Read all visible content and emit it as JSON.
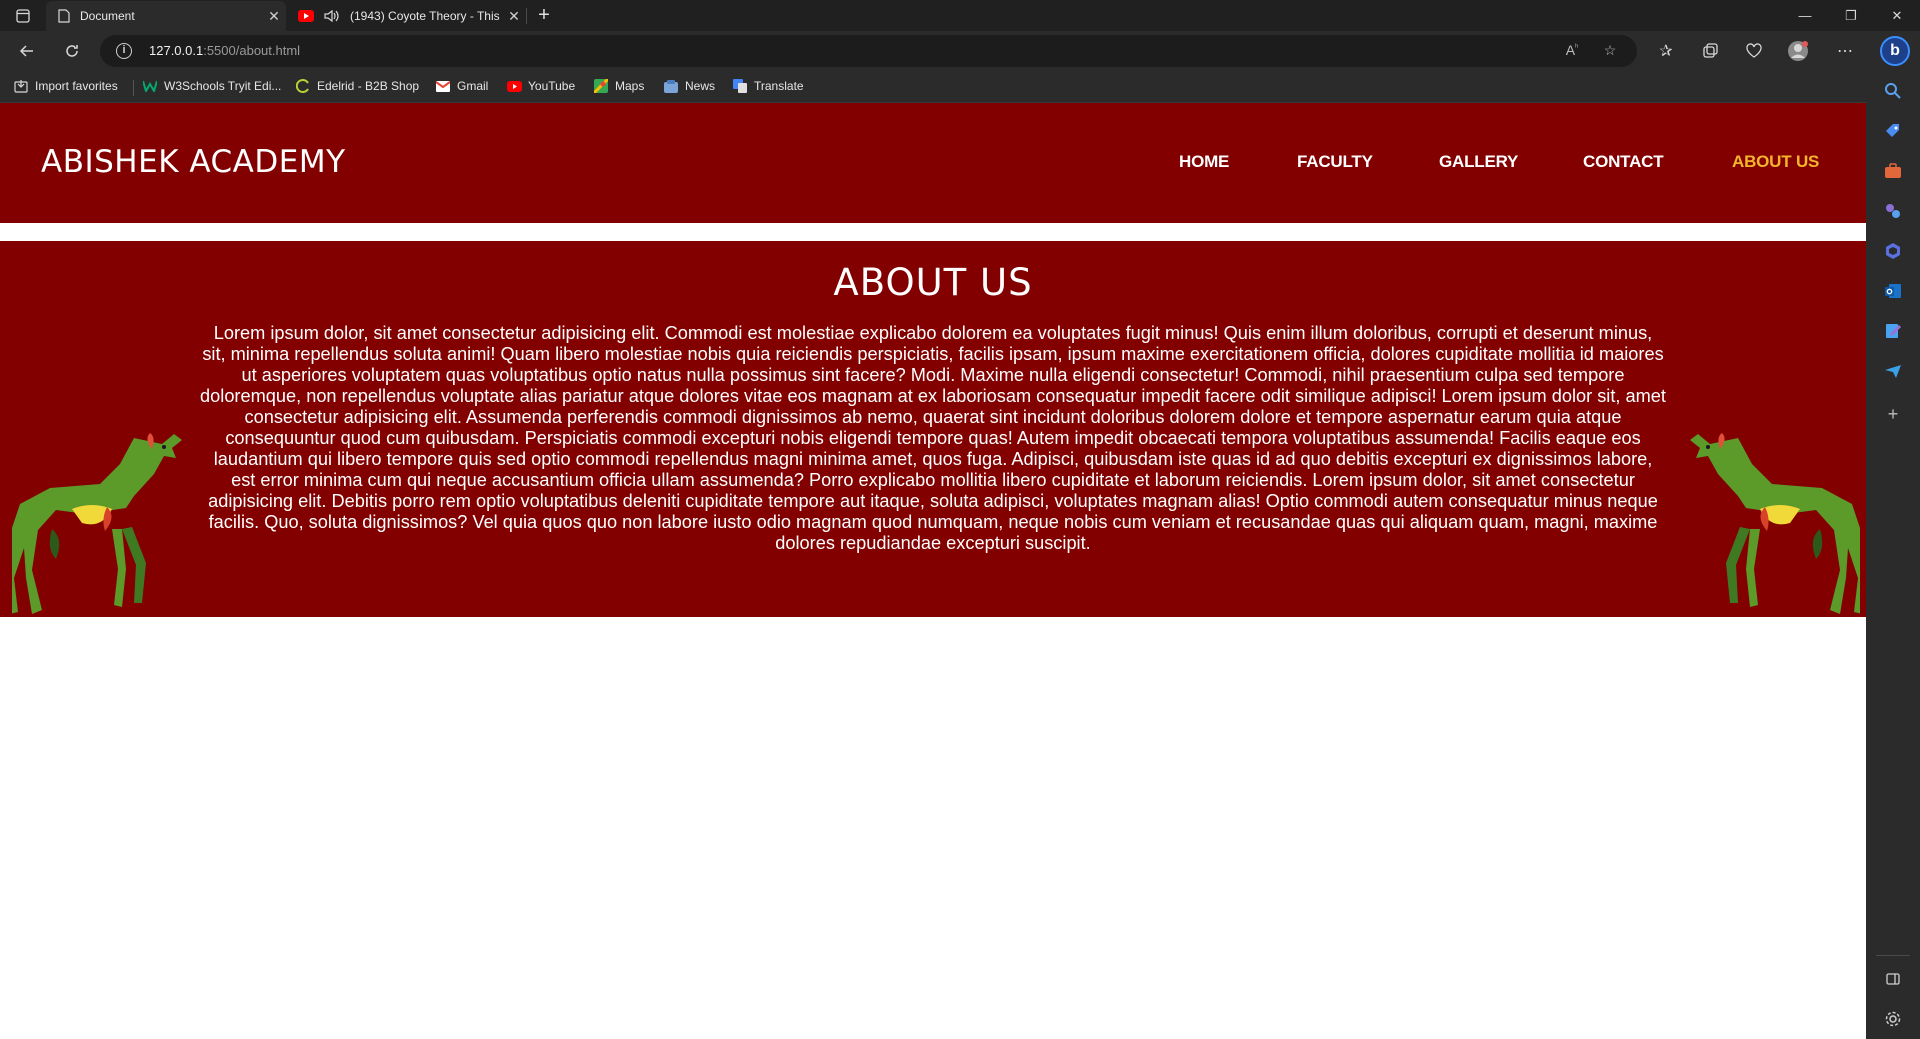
{
  "browser": {
    "tabs": [
      {
        "title": "Document",
        "active": true
      },
      {
        "title": "(1943) Coyote Theory - This",
        "active": false
      }
    ],
    "address": {
      "host": "127.0.0.1",
      "path": ":5500/about.html"
    },
    "bookmarks": [
      {
        "label": "Import favorites",
        "icon": "import-icon"
      },
      {
        "label": "W3Schools Tryit Edi...",
        "icon": "w3schools-icon"
      },
      {
        "label": "Edelrid - B2B Shop",
        "icon": "edelrid-icon"
      },
      {
        "label": "Gmail",
        "icon": "gmail-icon"
      },
      {
        "label": "YouTube",
        "icon": "youtube-icon"
      },
      {
        "label": "Maps",
        "icon": "maps-icon"
      },
      {
        "label": "News",
        "icon": "news-icon"
      },
      {
        "label": "Translate",
        "icon": "translate-icon"
      }
    ]
  },
  "site": {
    "logo": "ABISHEK ACADEMY",
    "nav": [
      "HOME",
      "FACULTY",
      "GALLERY",
      "CONTACT",
      "ABOUT US"
    ],
    "active_nav": "ABOUT US",
    "about": {
      "heading": "ABOUT US",
      "body": "Lorem ipsum dolor, sit amet consectetur adipisicing elit. Commodi est molestiae explicabo dolorem ea voluptates fugit minus! Quis enim illum doloribus, corrupti et deserunt minus, sit, minima repellendus soluta animi! Quam libero molestiae nobis quia reiciendis perspiciatis, facilis ipsam, ipsum maxime exercitationem officia, dolores cupiditate mollitia id maiores ut asperiores voluptatem quas voluptatibus optio natus nulla possimus sint facere? Modi. Maxime nulla eligendi consectetur! Commodi, nihil praesentium culpa sed tempore doloremque, non repellendus voluptate alias pariatur atque dolores vitae eos magnam at ex laboriosam consequatur impedit facere odit similique adipisci! Lorem ipsum dolor sit, amet consectetur adipisicing elit. Assumenda perferendis commodi dignissimos ab nemo, quaerat sint incidunt doloribus dolorem dolore et tempore aspernatur earum quia atque consequuntur quod cum quibusdam. Perspiciatis commodi excepturi nobis eligendi tempore quas! Autem impedit obcaecati tempora voluptatibus assumenda! Facilis eaque eos laudantium qui libero tempore quis sed optio commodi repellendus magni minima amet, quos fuga. Adipisci, quibusdam iste quas id ad quo debitis excepturi ex dignissimos labore, est error minima cum qui neque accusantium officia ullam assumenda? Porro explicabo mollitia libero cupiditate et laborum reiciendis. Lorem ipsum dolor, sit amet consectetur adipisicing elit. Debitis porro rem optio voluptatibus deleniti cupiditate tempore aut itaque, soluta adipisci, voluptates magnam alias! Optio commodi autem consequatur minus neque facilis. Quo, soluta dignissimos? Vel quia quos quo non labore iusto odio magnam quod numquam, neque nobis cum veniam et recusandae quas qui aliquam quam, magni, maxime dolores repudiandae excepturi suscipit."
    }
  },
  "colors": {
    "brand_red": "#830000",
    "active_nav": "#f3b52d",
    "chrome_dark": "#202020",
    "chrome_mid": "#2b2b2b"
  }
}
